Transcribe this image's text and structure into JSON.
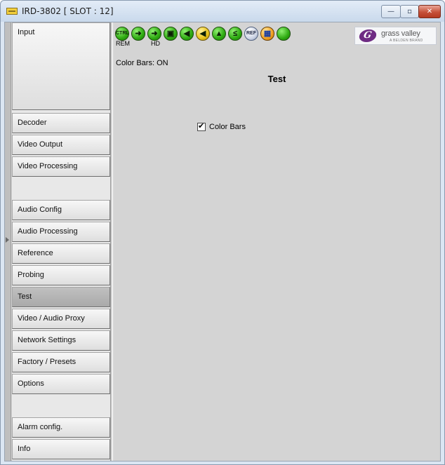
{
  "window": {
    "title": "IRD-3802 [ SLOT : 12]",
    "controls": {
      "minimize": "—",
      "maximize": "▫",
      "close": "✕"
    }
  },
  "sidebar": {
    "items": [
      {
        "label": "Input",
        "active": false
      },
      {
        "label": "Decoder",
        "active": false
      },
      {
        "label": "Video Output",
        "active": false
      },
      {
        "label": "Video Processing",
        "active": false
      },
      {
        "label": "Audio Config",
        "active": false
      },
      {
        "label": "Audio Processing",
        "active": false
      },
      {
        "label": "Reference",
        "active": false
      },
      {
        "label": "Probing",
        "active": false
      },
      {
        "label": "Test",
        "active": true
      },
      {
        "label": "Video / Audio Proxy",
        "active": false
      },
      {
        "label": "Network Settings",
        "active": false
      },
      {
        "label": "Factory / Presets",
        "active": false
      },
      {
        "label": "Options",
        "active": false
      },
      {
        "label": "Alarm config.",
        "active": false
      },
      {
        "label": "Info",
        "active": false
      }
    ]
  },
  "toolbar": {
    "icons": [
      {
        "name": "ctrl-icon",
        "glyph": "CTRL",
        "caption": "REM"
      },
      {
        "name": "input-arrow-icon",
        "glyph": "➜",
        "caption": ""
      },
      {
        "name": "hd-arrow-icon",
        "glyph": "➜",
        "caption": "HD"
      },
      {
        "name": "lock-icon",
        "glyph": "▣",
        "caption": ""
      },
      {
        "name": "audio-speaker-icon",
        "glyph": "◀",
        "caption": ""
      },
      {
        "name": "audio-speaker-2-icon",
        "glyph": "◀",
        "caption": ""
      },
      {
        "name": "audio-lock-icon",
        "glyph": "▲",
        "caption": ""
      },
      {
        "name": "less-than-icon",
        "glyph": "≤",
        "caption": ""
      },
      {
        "name": "ref-icon",
        "glyph": "REF",
        "caption": ""
      },
      {
        "name": "color-bars-icon",
        "glyph": "▦",
        "caption": ""
      },
      {
        "name": "status-led-icon",
        "glyph": "",
        "caption": ""
      }
    ]
  },
  "logo": {
    "name": "grass valley",
    "sub": "A BELDEN BRAND"
  },
  "status_text": "Color Bars: ON",
  "panel": {
    "title": "Test",
    "checkbox_label": "Color Bars",
    "checkbox_checked": true
  }
}
